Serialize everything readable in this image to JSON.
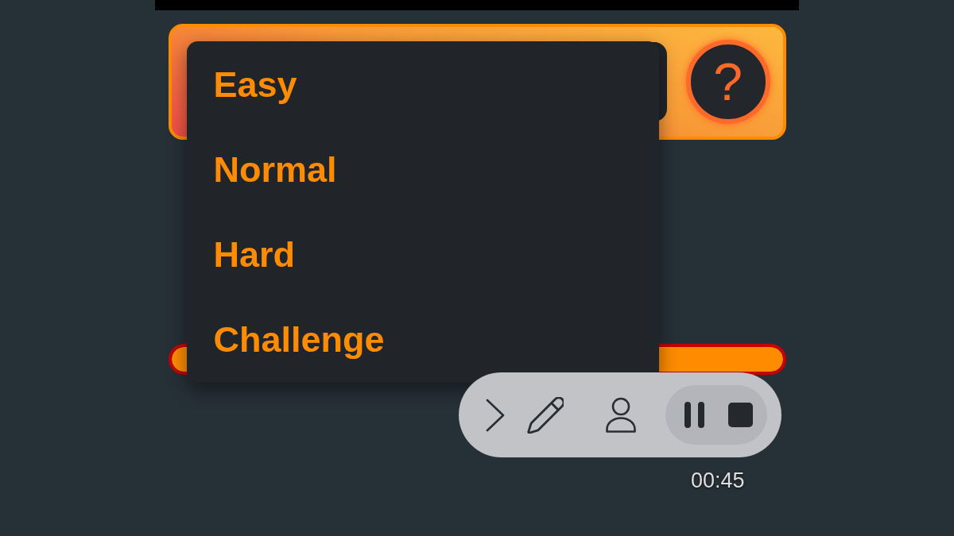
{
  "header": {
    "help_button": {
      "label": "?"
    }
  },
  "difficulty_menu": {
    "items": [
      {
        "label": "Easy"
      },
      {
        "label": "Normal"
      },
      {
        "label": "Hard"
      },
      {
        "label": "Challenge"
      }
    ]
  },
  "progress": {
    "level": 1
  },
  "controls": {
    "buttons": [
      {
        "kind": "next"
      },
      {
        "kind": "edit"
      },
      {
        "kind": "profile"
      }
    ],
    "playback": [
      {
        "kind": "pause"
      },
      {
        "kind": "stop"
      }
    ]
  },
  "timer": "00:45"
}
